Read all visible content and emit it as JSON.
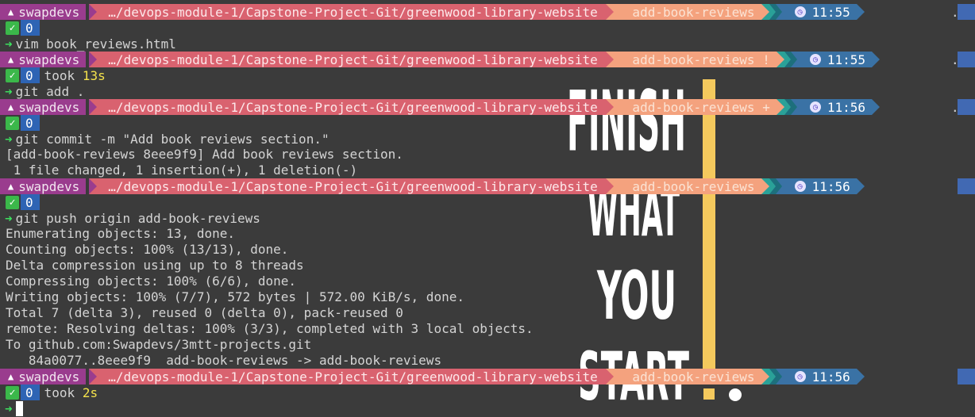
{
  "wallpaper": {
    "lines": [
      "FINISH",
      "WHAT",
      "YOU",
      "START"
    ],
    "accent_color": "#f4c95d",
    "text_color": "#ffffff"
  },
  "prompts": [
    {
      "user": "swapdevs",
      "path": "…/devops-module-1/Capstone-Project-Git/greenwood-library-website",
      "branch": " add-book-reviews",
      "time": "11:55",
      "end": "."
    },
    {
      "user": "swapdevs",
      "path": "…/devops-module-1/Capstone-Project-Git/greenwood-library-website",
      "branch": " add-book-reviews !",
      "time": "11:55",
      "end": "."
    },
    {
      "user": "swapdevs",
      "path": "…/devops-module-1/Capstone-Project-Git/greenwood-library-website",
      "branch": " add-book-reviews +",
      "time": "11:56",
      "end": "."
    },
    {
      "user": "swapdevs",
      "path": "…/devops-module-1/Capstone-Project-Git/greenwood-library-website",
      "branch": " add-book-reviews",
      "time": "11:56",
      "end": ""
    },
    {
      "user": "swapdevs",
      "path": "…/devops-module-1/Capstone-Project-Git/greenwood-library-website",
      "branch": " add-book-reviews",
      "time": "11:56",
      "end": ""
    }
  ],
  "statuses": [
    {
      "code": "0",
      "took": "",
      "took_val": ""
    },
    {
      "code": "0",
      "took": "took ",
      "took_val": "13s"
    },
    {
      "code": "0",
      "took": "",
      "took_val": ""
    },
    {
      "code": "0",
      "took": "",
      "took_val": ""
    },
    {
      "code": "0",
      "took": "took ",
      "took_val": "2s"
    }
  ],
  "commands": [
    "vim book_reviews.html",
    "git add .",
    "git commit -m \"Add book reviews section.\"",
    "git push origin add-book-reviews"
  ],
  "outputs": {
    "commit": [
      "[add-book-reviews 8eee9f9] Add book reviews section.",
      " 1 file changed, 1 insertion(+), 1 deletion(-)"
    ],
    "push": [
      "Enumerating objects: 13, done.",
      "Counting objects: 100% (13/13), done.",
      "Delta compression using up to 8 threads",
      "Compressing objects: 100% (6/6), done.",
      "Writing objects: 100% (7/7), 572 bytes | 572.00 KiB/s, done.",
      "Total 7 (delta 3), reused 0 (delta 0), pack-reused 0",
      "remote: Resolving deltas: 100% (3/3), completed with 3 local objects.",
      "To github.com:Swapdevs/3mtt-projects.git",
      "   84a0077..8eee9f9  add-book-reviews -> add-book-reviews"
    ]
  },
  "icons": {
    "user": "linux-icon",
    "status": "check-icon",
    "time": "clock-icon",
    "prompt_arrow": "arrow-icon"
  },
  "colors": {
    "background": "#3b3b3b",
    "user_segment": "#9a3c8e",
    "path_segment": "#d9626f",
    "git_segment": "#f4a27e",
    "time_segment": "#3a72a5",
    "success": "#3bb84a",
    "exit_code": "#2e64b4",
    "prompt_arrow": "#3cdf5e",
    "duration": "#f4e24c"
  }
}
